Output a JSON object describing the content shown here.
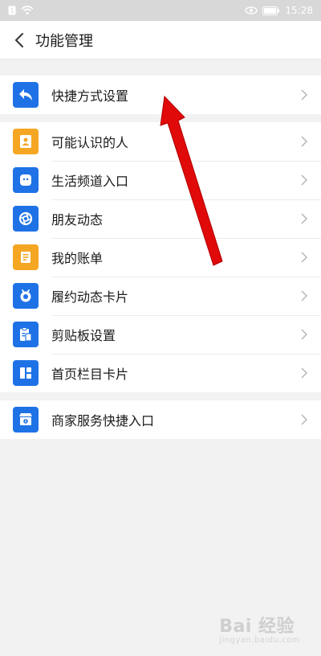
{
  "statusbar": {
    "time": "15:28"
  },
  "header": {
    "title": "功能管理"
  },
  "groups": [
    {
      "items": [
        {
          "label": "快捷方式设置",
          "icon": "shortcut-icon",
          "color": "#1e72e6"
        }
      ]
    },
    {
      "items": [
        {
          "label": "可能认识的人",
          "icon": "contacts-icon",
          "color": "#f5a623"
        },
        {
          "label": "生活频道入口",
          "icon": "life-channel-icon",
          "color": "#1e72e6"
        },
        {
          "label": "朋友动态",
          "icon": "friend-feed-icon",
          "color": "#1e72e6"
        },
        {
          "label": "我的账单",
          "icon": "bill-icon",
          "color": "#f5a623"
        },
        {
          "label": "履约动态卡片",
          "icon": "fulfillment-icon",
          "color": "#1e72e6"
        },
        {
          "label": "剪贴板设置",
          "icon": "clipboard-icon",
          "color": "#1e72e6"
        },
        {
          "label": "首页栏目卡片",
          "icon": "home-card-icon",
          "color": "#1e72e6"
        }
      ]
    },
    {
      "items": [
        {
          "label": "商家服务快捷入口",
          "icon": "merchant-service-icon",
          "color": "#1e72e6"
        }
      ]
    }
  ],
  "watermark": {
    "brand": "Bai 经验",
    "sub": "jingyan.baidu.com"
  }
}
